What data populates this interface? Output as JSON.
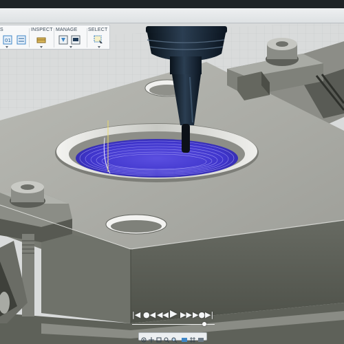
{
  "toolbar": {
    "groups": [
      {
        "label": "S"
      },
      {
        "label": "INSPECT"
      },
      {
        "label": "MANAGE"
      },
      {
        "label": "SELECT"
      }
    ]
  },
  "playback": {
    "buttons": [
      "|◀",
      "●◀",
      "◀◀",
      "▶",
      "▶▶",
      "▶●",
      "▶|"
    ]
  },
  "colors": {
    "accent": "#3f86c6",
    "toolpath": "#3d35d6",
    "stock": "#aaaba5",
    "spindle": "#0f1b26"
  },
  "icons": [
    "sketch-dimension-icon",
    "measure-icon",
    "tool-library-icon",
    "post-process-icon",
    "select-icon",
    "orbit-icon",
    "pan-icon",
    "look-at-icon",
    "zoom-icon",
    "zoom-fit-icon",
    "display-settings-icon",
    "grid-icon"
  ]
}
